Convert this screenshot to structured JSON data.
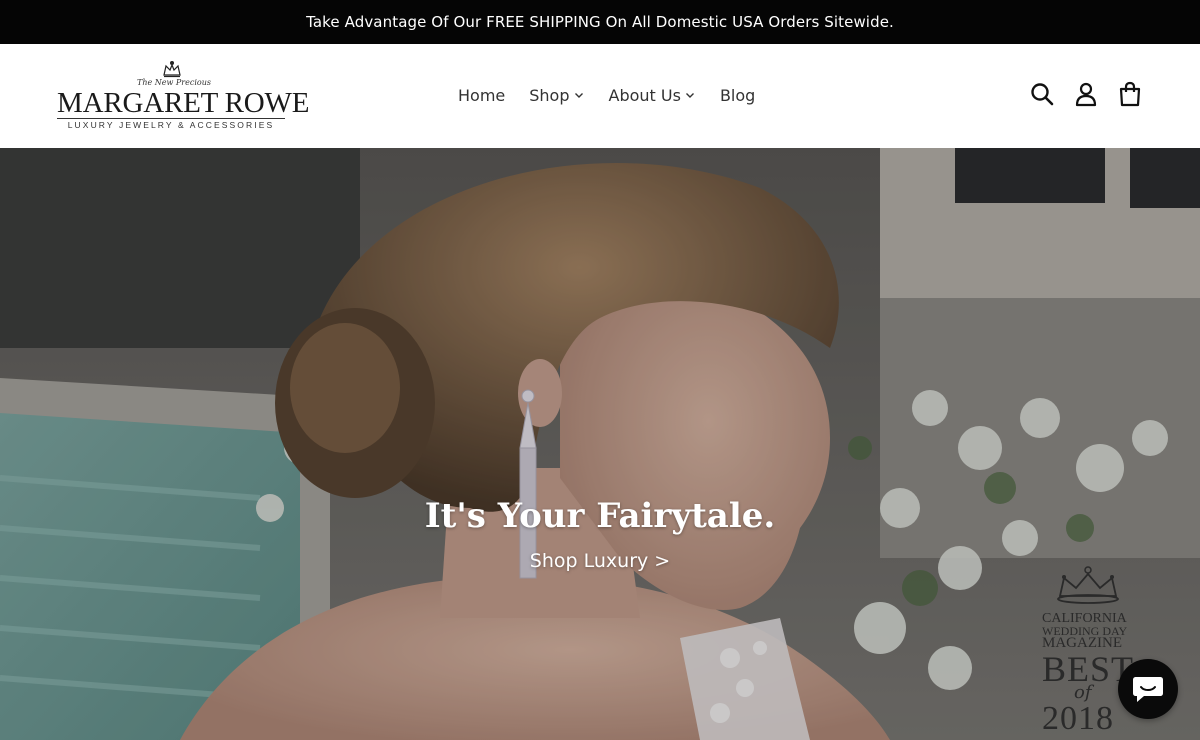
{
  "announcement": {
    "text": "Take Advantage Of Our FREE SHIPPING On All Domestic USA Orders Sitewide."
  },
  "logo": {
    "tagline": "The New Precious",
    "name": "MARGARET ROWE",
    "subtitle": "LUXURY JEWELRY & ACCESSORIES"
  },
  "nav": {
    "items": [
      {
        "label": "Home",
        "dropdown": false
      },
      {
        "label": "Shop",
        "dropdown": true
      },
      {
        "label": "About Us",
        "dropdown": true
      },
      {
        "label": "Blog",
        "dropdown": false
      }
    ]
  },
  "header_icons": [
    "search-icon",
    "account-icon",
    "cart-icon"
  ],
  "hero": {
    "title": "It's Your Fairytale.",
    "link_label": "Shop Luxury >"
  },
  "award": {
    "line1": "CALIFORNIA",
    "line2": "WEDDING DAY",
    "line3": "MAGAZINE",
    "best": "BEST",
    "of": "of",
    "year": "2018"
  },
  "chat": {
    "icon": "chat-icon"
  },
  "colors": {
    "announcement_bg": "#050505",
    "announcement_text": "#ffffff",
    "nav_text": "#333333",
    "hero_text": "#ffffff"
  }
}
